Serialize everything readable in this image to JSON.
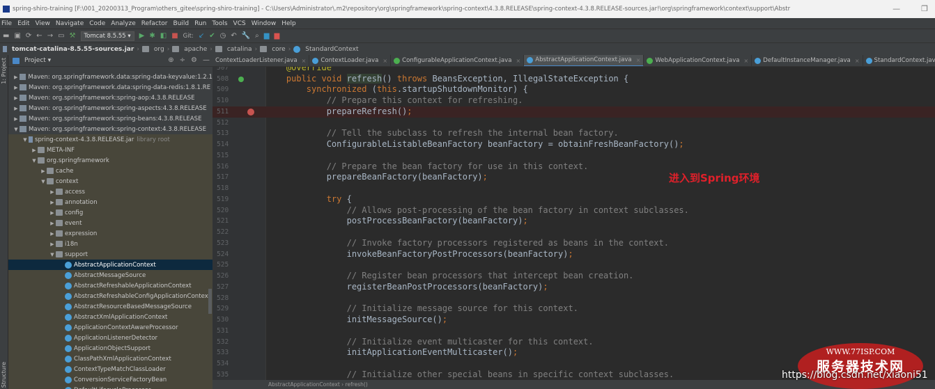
{
  "titlebar": {
    "text": "spring-shiro-training [F:\\001_20200313_Program\\others_gitee\\spring-shiro-training] - C:\\Users\\Administrator\\.m2\\repository\\org\\springframework\\spring-context\\4.3.8.RELEASE\\spring-context-4.3.8.RELEASE-sources.jar!\\org\\springframework\\context\\support\\Abstr",
    "minimize": "—",
    "restore": "❐"
  },
  "menu": [
    "File",
    "Edit",
    "View",
    "Navigate",
    "Code",
    "Analyze",
    "Refactor",
    "Build",
    "Run",
    "Tools",
    "VCS",
    "Window",
    "Help"
  ],
  "toolbar": {
    "run_config": "Tomcat 8.5.55",
    "git_label": "Git:"
  },
  "breadcrumb": [
    "tomcat-catalina-8.5.55-sources.jar",
    "org",
    "apache",
    "catalina",
    "core",
    "StandardContext"
  ],
  "sidebar": {
    "strip_top": "1: Project",
    "strip_bottom": "Structure",
    "header": "Project ▾"
  },
  "tree": [
    {
      "label": "Maven: org.springframework.data:spring-data-keyvalue:1.2.1",
      "depth": 0,
      "icon": "maven",
      "arrow": "▶",
      "zone": "lib"
    },
    {
      "label": "Maven: org.springframework.data:spring-data-redis:1.8.1.RE",
      "depth": 0,
      "icon": "maven",
      "arrow": "▶",
      "zone": "lib"
    },
    {
      "label": "Maven: org.springframework:spring-aop:4.3.8.RELEASE",
      "depth": 0,
      "icon": "maven",
      "arrow": "▶",
      "zone": "lib"
    },
    {
      "label": "Maven: org.springframework:spring-aspects:4.3.8.RELEASE",
      "depth": 0,
      "icon": "maven",
      "arrow": "▶",
      "zone": "lib"
    },
    {
      "label": "Maven: org.springframework:spring-beans:4.3.8.RELEASE",
      "depth": 0,
      "icon": "maven",
      "arrow": "▶",
      "zone": "lib"
    },
    {
      "label": "Maven: org.springframework:spring-context:4.3.8.RELEASE",
      "depth": 0,
      "icon": "maven",
      "arrow": "▼",
      "zone": "lib"
    },
    {
      "label": "spring-context-4.3.8.RELEASE.jar",
      "extra": "library root",
      "depth": 1,
      "icon": "jar",
      "arrow": "▼",
      "zone": "src"
    },
    {
      "label": "META-INF",
      "depth": 2,
      "icon": "folder",
      "arrow": "▶",
      "zone": "src"
    },
    {
      "label": "org.springframework",
      "depth": 2,
      "icon": "folder",
      "arrow": "▼",
      "zone": "src"
    },
    {
      "label": "cache",
      "depth": 3,
      "icon": "folder",
      "arrow": "▶",
      "zone": "src"
    },
    {
      "label": "context",
      "depth": 3,
      "icon": "folder",
      "arrow": "▼",
      "zone": "src"
    },
    {
      "label": "access",
      "depth": 4,
      "icon": "folder",
      "arrow": "▶",
      "zone": "src"
    },
    {
      "label": "annotation",
      "depth": 4,
      "icon": "folder",
      "arrow": "▶",
      "zone": "src"
    },
    {
      "label": "config",
      "depth": 4,
      "icon": "folder",
      "arrow": "▶",
      "zone": "src"
    },
    {
      "label": "event",
      "depth": 4,
      "icon": "folder",
      "arrow": "▶",
      "zone": "src"
    },
    {
      "label": "expression",
      "depth": 4,
      "icon": "folder",
      "arrow": "▶",
      "zone": "src"
    },
    {
      "label": "i18n",
      "depth": 4,
      "icon": "folder",
      "arrow": "▶",
      "zone": "src"
    },
    {
      "label": "support",
      "depth": 4,
      "icon": "folder",
      "arrow": "▼",
      "zone": "src"
    },
    {
      "label": "AbstractApplicationContext",
      "depth": 5,
      "icon": "cls",
      "arrow": "",
      "zone": "sel"
    },
    {
      "label": "AbstractMessageSource",
      "depth": 5,
      "icon": "cls",
      "arrow": "",
      "zone": "src"
    },
    {
      "label": "AbstractRefreshableApplicationContext",
      "depth": 5,
      "icon": "cls",
      "arrow": "",
      "zone": "src"
    },
    {
      "label": "AbstractRefreshableConfigApplicationContext",
      "depth": 5,
      "icon": "cls",
      "arrow": "",
      "zone": "src"
    },
    {
      "label": "AbstractResourceBasedMessageSource",
      "depth": 5,
      "icon": "cls",
      "arrow": "",
      "zone": "src"
    },
    {
      "label": "AbstractXmlApplicationContext",
      "depth": 5,
      "icon": "cls",
      "arrow": "",
      "zone": "src"
    },
    {
      "label": "ApplicationContextAwareProcessor",
      "depth": 5,
      "icon": "cls",
      "arrow": "",
      "zone": "src"
    },
    {
      "label": "ApplicationListenerDetector",
      "depth": 5,
      "icon": "cls",
      "arrow": "",
      "zone": "src"
    },
    {
      "label": "ApplicationObjectSupport",
      "depth": 5,
      "icon": "cls",
      "arrow": "",
      "zone": "src"
    },
    {
      "label": "ClassPathXmlApplicationContext",
      "depth": 5,
      "icon": "cls",
      "arrow": "",
      "zone": "src"
    },
    {
      "label": "ContextTypeMatchClassLoader",
      "depth": 5,
      "icon": "cls",
      "arrow": "",
      "zone": "src"
    },
    {
      "label": "ConversionServiceFactoryBean",
      "depth": 5,
      "icon": "cls",
      "arrow": "",
      "zone": "src"
    },
    {
      "label": "DefaultLifecycleProcessor",
      "depth": 5,
      "icon": "cls",
      "arrow": "",
      "zone": "src"
    }
  ],
  "tabs": [
    {
      "label": "ContextLoaderListener.java",
      "icon": "none"
    },
    {
      "label": "ContextLoader.java",
      "icon": "class"
    },
    {
      "label": "ConfigurableApplicationContext.java",
      "icon": "interface"
    },
    {
      "label": "AbstractApplicationContext.java",
      "icon": "class",
      "active": true
    },
    {
      "label": "WebApplicationContext.java",
      "icon": "interface"
    },
    {
      "label": "DefaultInstanceManager.java",
      "icon": "class"
    },
    {
      "label": "StandardContext.java",
      "icon": "class"
    }
  ],
  "code": [
    {
      "n": "507",
      "t": [
        [
          "    ",
          ""
        ],
        [
          "@Override",
          "an"
        ]
      ]
    },
    {
      "n": "508",
      "mark": "override",
      "t": [
        [
          "    ",
          ""
        ],
        [
          "public void ",
          "k"
        ],
        [
          "refresh",
          "hl"
        ],
        [
          "() ",
          ""
        ],
        [
          "throws ",
          "k"
        ],
        [
          "BeansException, IllegalStateException {",
          ""
        ]
      ]
    },
    {
      "n": "509",
      "t": [
        [
          "        ",
          ""
        ],
        [
          "synchronized ",
          "k"
        ],
        [
          "(",
          ""
        ],
        [
          "this",
          "k"
        ],
        [
          ".startupShutdownMonitor) {",
          ""
        ]
      ]
    },
    {
      "n": "510",
      "t": [
        [
          "            ",
          ""
        ],
        [
          "// Prepare this context for refreshing.",
          "cm"
        ]
      ]
    },
    {
      "n": "511",
      "mark": "breakpoint",
      "t": [
        [
          "            prepareRefresh()",
          ""
        ],
        [
          ";",
          "p"
        ]
      ]
    },
    {
      "n": "512",
      "t": []
    },
    {
      "n": "513",
      "t": [
        [
          "            ",
          ""
        ],
        [
          "// Tell the subclass to refresh the internal bean factory.",
          "cm"
        ]
      ]
    },
    {
      "n": "514",
      "t": [
        [
          "            ConfigurableListableBeanFactory beanFactory = obtainFreshBeanFactory()",
          ""
        ],
        [
          ";",
          "p"
        ]
      ]
    },
    {
      "n": "515",
      "t": []
    },
    {
      "n": "516",
      "t": [
        [
          "            ",
          ""
        ],
        [
          "// Prepare the bean factory for use in this context.",
          "cm"
        ]
      ]
    },
    {
      "n": "517",
      "t": [
        [
          "            prepareBeanFactory(beanFactory)",
          ""
        ],
        [
          ";",
          "p"
        ]
      ]
    },
    {
      "n": "518",
      "t": []
    },
    {
      "n": "519",
      "t": [
        [
          "            ",
          ""
        ],
        [
          "try ",
          "k"
        ],
        [
          "{",
          ""
        ]
      ]
    },
    {
      "n": "520",
      "t": [
        [
          "                ",
          ""
        ],
        [
          "// Allows post-processing of the bean factory in context subclasses.",
          "cm"
        ]
      ]
    },
    {
      "n": "521",
      "t": [
        [
          "                postProcessBeanFactory(beanFactory)",
          ""
        ],
        [
          ";",
          "p"
        ]
      ]
    },
    {
      "n": "522",
      "t": []
    },
    {
      "n": "523",
      "t": [
        [
          "                ",
          ""
        ],
        [
          "// Invoke factory processors registered as beans in the context.",
          "cm"
        ]
      ]
    },
    {
      "n": "524",
      "t": [
        [
          "                invokeBeanFactoryPostProcessors(beanFactory)",
          ""
        ],
        [
          ";",
          "p"
        ]
      ]
    },
    {
      "n": "525",
      "t": []
    },
    {
      "n": "526",
      "t": [
        [
          "                ",
          ""
        ],
        [
          "// Register bean processors that intercept bean creation.",
          "cm"
        ]
      ]
    },
    {
      "n": "527",
      "t": [
        [
          "                registerBeanPostProcessors(beanFactory)",
          ""
        ],
        [
          ";",
          "p"
        ]
      ]
    },
    {
      "n": "528",
      "t": []
    },
    {
      "n": "529",
      "t": [
        [
          "                ",
          ""
        ],
        [
          "// Initialize message source for this context.",
          "cm"
        ]
      ]
    },
    {
      "n": "530",
      "t": [
        [
          "                initMessageSource()",
          ""
        ],
        [
          ";",
          "p"
        ]
      ]
    },
    {
      "n": "531",
      "t": []
    },
    {
      "n": "532",
      "t": [
        [
          "                ",
          ""
        ],
        [
          "// Initialize event multicaster for this context.",
          "cm"
        ]
      ]
    },
    {
      "n": "533",
      "t": [
        [
          "                initApplicationEventMulticaster()",
          ""
        ],
        [
          ";",
          "p"
        ]
      ]
    },
    {
      "n": "534",
      "t": []
    },
    {
      "n": "535",
      "t": [
        [
          "                ",
          ""
        ],
        [
          "// Initialize other special beans in specific context subclasses.",
          "cm"
        ]
      ]
    }
  ],
  "annotation": "进入到Spring环境",
  "status_breadcrumb": "AbstractApplicationContext  ›  refresh()",
  "watermark": {
    "site": "WWW.77ISP.COM",
    "name": "服务器技术网",
    "url": "https://blog.csdn.net/xiaoni51"
  },
  "colors": {
    "keyword": "#cc7832",
    "comment": "#808080",
    "breakpoint": "#c75450",
    "annotation": "#e0202a",
    "selection": "#0d293e"
  }
}
